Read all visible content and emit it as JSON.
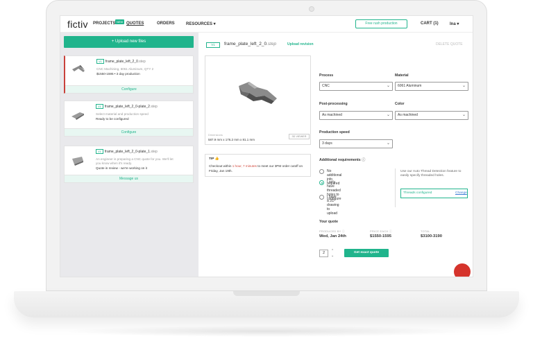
{
  "nav": {
    "logo": "fictiv",
    "projects": "PROJECTS",
    "new_badge": "NEW",
    "quotes": "QUOTES",
    "orders": "ORDERS",
    "resources": "RESOURCES ▾",
    "rush": "Free rush production",
    "cart": "CART (1)",
    "user": "Ina ▾"
  },
  "sidebar": {
    "upload": "+ Upload new files",
    "cards": [
      {
        "version": "V1",
        "name": "frame_plate_left_2_0",
        "ext": ".step",
        "line1": "CNC Machining, 6061 Aluminum, QTY 2",
        "line2": "$1550-1595 • 3 day production",
        "action": "Configure"
      },
      {
        "version": "V1",
        "name": "frame_plate_left_2_0-plate_2",
        "ext": ".step",
        "line1": "Select material and production speed",
        "line2": "Ready to be configured",
        "action": "Configure"
      },
      {
        "version": "V1",
        "name": "frame_plate_left_2_0-plate_1",
        "ext": ".step",
        "line1": "An engineer is preparing a CNC quote for you. We'll let",
        "line1b": "you know when it's ready.",
        "line2": "Quote in review - we're working on it",
        "action": "Message us"
      }
    ]
  },
  "main": {
    "version": "V1",
    "file": "frame_plate_left_2_0",
    "ext": ".step",
    "upload_revision": "Upload revision",
    "delete_quote": "DELETE QUOTE",
    "dimensions_label": "Dimensions",
    "dimensions": "587.9 mm x 176.2 mm x 81.1 mm",
    "viewer_3d": "3D VIEWER",
    "tip_title": "TIP",
    "tip_text_1": "Checkout within ",
    "tip_highlight": "1 hour, 7 minutes",
    "tip_text_2": " to meet our 3PM order cutoff on Friday, Jan 19th.",
    "process_label": "Process",
    "process_value": "CNC",
    "material_label": "Material",
    "material_value": "6061 Aluminum",
    "post_label": "Post-processing",
    "post_value": "As machined",
    "color_label": "Color",
    "color_value": "As machined",
    "speed_label": "Production speed",
    "speed_value": "3 days",
    "addl_label": "Additional requirements",
    "options": [
      {
        "label": "No additional info required",
        "selected": false
      },
      {
        "label": "I only have threaded holes to",
        "label2": "configure",
        "selected": true
      },
      {
        "label": "I have a 2D drawing to upload",
        "selected": false
      }
    ],
    "note": "Use our Auto Thread Detection feature to easily specify threaded holes.",
    "threads_configured": "Threads configured",
    "change": "Change",
    "your_quote": "Your quote",
    "produced_by_label": "PRODUCED BY",
    "produced_by": "Wed, Jan 24th",
    "price_each_label": "PRICE EACH",
    "price_each": "$1550-1595",
    "total_label": "TOTAL",
    "total": "$3100-3190",
    "qty": "2",
    "exact_quote": "Get exact quote"
  },
  "colors": {
    "accent": "#20b48c",
    "alert": "#d0463b",
    "chat": "#d5342c"
  },
  "icons": [
    "chevron-down-icon",
    "thumbs-up-icon",
    "info-icon",
    "chat-icon"
  ]
}
